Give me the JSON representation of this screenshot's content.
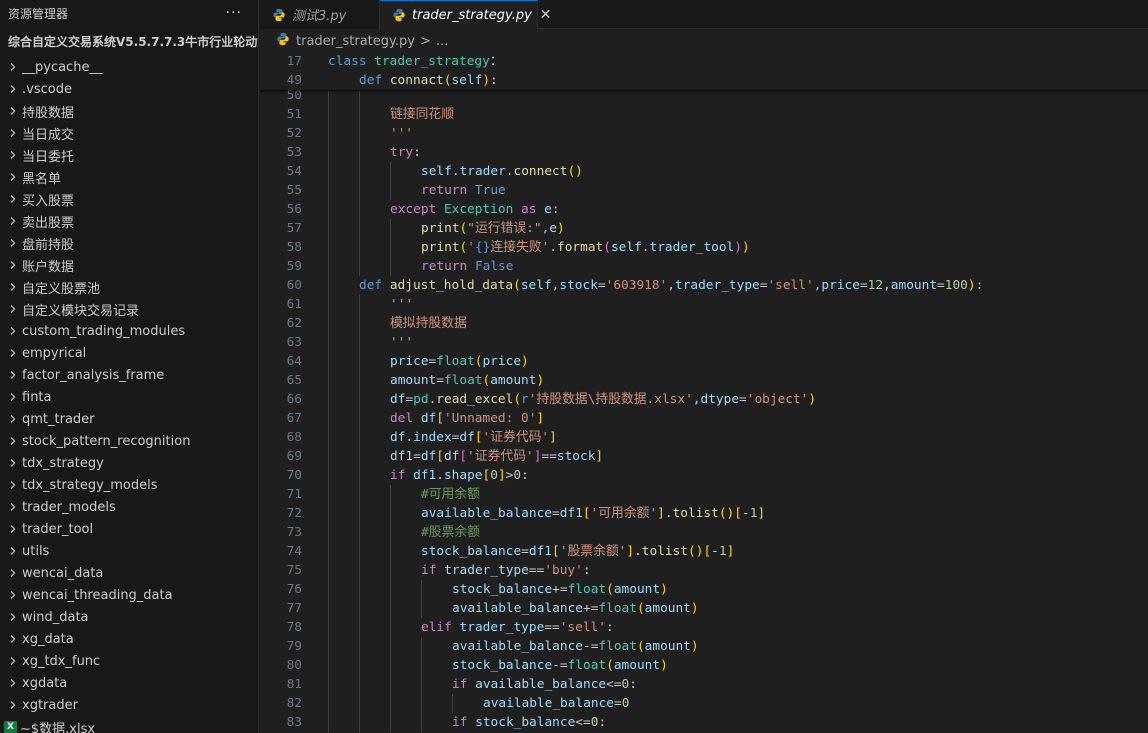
{
  "sidebar": {
    "title": "资源管理器",
    "more": "···",
    "root": "综合自定义交易系统V5.5.7.7.3牛市行业轮动策略",
    "items": [
      "__pycache__",
      ".vscode",
      "持股数据",
      "当日成交",
      "当日委托",
      "黑名单",
      "买入股票",
      "卖出股票",
      "盘前持股",
      "账户数据",
      "自定义股票池",
      "自定义模块交易记录",
      "custom_trading_modules",
      "empyrical",
      "factor_analysis_frame",
      "finta",
      "qmt_trader",
      "stock_pattern_recognition",
      "tdx_strategy",
      "tdx_strategy_models",
      "trader_models",
      "trader_tool",
      "utils",
      "wencai_data",
      "wencai_threading_data",
      "wind_data",
      "xg_data",
      "xg_tdx_func",
      "xgdata",
      "xgtrader"
    ],
    "file": "~$数据.xlsx",
    "file_icon_text": "X"
  },
  "tabs": [
    {
      "label": "测试3.py",
      "active": false
    },
    {
      "label": "trader_strategy.py",
      "active": true,
      "close": "✕"
    }
  ],
  "breadcrumb": {
    "file": "trader_strategy.py",
    "sep": ">",
    "more": "..."
  },
  "editor": {
    "sticky": [
      {
        "ln": "17",
        "indent": 0,
        "code": [
          [
            "k",
            "class"
          ],
          [
            "t",
            " trader_strategy"
          ],
          [
            "",
            "："
          ]
        ]
      },
      {
        "ln": "49",
        "indent": 1,
        "code": [
          [
            "k",
            "def"
          ],
          [
            "f",
            " connact"
          ],
          [
            "p",
            "("
          ],
          [
            "v",
            "self"
          ],
          [
            "p",
            ")"
          ],
          [
            "",
            ":"
          ]
        ]
      }
    ],
    "lines": [
      {
        "ln": "50",
        "indent": 2,
        "code": []
      },
      {
        "ln": "51",
        "indent": 2,
        "code": [
          [
            "s",
            "链接同花顺"
          ]
        ]
      },
      {
        "ln": "52",
        "indent": 2,
        "code": [
          [
            "s",
            "'''"
          ]
        ]
      },
      {
        "ln": "53",
        "indent": 2,
        "code": [
          [
            "kc",
            "try"
          ],
          [
            "",
            ":"
          ]
        ]
      },
      {
        "ln": "54",
        "indent": 3,
        "code": [
          [
            "v",
            "self"
          ],
          [
            "",
            "."
          ],
          [
            "v",
            "trader"
          ],
          [
            "",
            "."
          ],
          [
            "f",
            "connect"
          ],
          [
            "p",
            "()"
          ]
        ]
      },
      {
        "ln": "55",
        "indent": 3,
        "code": [
          [
            "kc",
            "return"
          ],
          [
            "k",
            " True"
          ]
        ]
      },
      {
        "ln": "56",
        "indent": 2,
        "code": [
          [
            "kc",
            "except"
          ],
          [
            "t",
            " Exception"
          ],
          [
            "kc",
            " as"
          ],
          [
            "v",
            " e"
          ],
          [
            "",
            ":"
          ]
        ]
      },
      {
        "ln": "57",
        "indent": 3,
        "code": [
          [
            "f",
            "print"
          ],
          [
            "p",
            "("
          ],
          [
            "s",
            "\"运行错误:\""
          ],
          [
            "",
            ","
          ],
          [
            "v",
            "e"
          ],
          [
            "p",
            ")"
          ]
        ]
      },
      {
        "ln": "58",
        "indent": 3,
        "code": [
          [
            "f",
            "print"
          ],
          [
            "p",
            "("
          ],
          [
            "s",
            "'"
          ],
          [
            "k",
            "{}"
          ],
          [
            "s",
            "连接失败'"
          ],
          [
            "",
            "."
          ],
          [
            "f",
            "format"
          ],
          [
            "p2",
            "("
          ],
          [
            "v",
            "self"
          ],
          [
            "",
            "."
          ],
          [
            "v",
            "trader_tool"
          ],
          [
            "p2",
            ")"
          ],
          [
            "p",
            ")"
          ]
        ]
      },
      {
        "ln": "59",
        "indent": 3,
        "code": [
          [
            "kc",
            "return"
          ],
          [
            "k",
            " False"
          ]
        ]
      },
      {
        "ln": "60",
        "indent": 1,
        "code": [
          [
            "k",
            "def"
          ],
          [
            "f",
            " adjust_hold_data"
          ],
          [
            "p",
            "("
          ],
          [
            "v",
            "self"
          ],
          [
            "",
            ","
          ],
          [
            "v",
            "stock"
          ],
          [
            "",
            "="
          ],
          [
            "s",
            "'603918'"
          ],
          [
            "",
            ","
          ],
          [
            "v",
            "trader_type"
          ],
          [
            "",
            "="
          ],
          [
            "s",
            "'sell'"
          ],
          [
            "",
            ","
          ],
          [
            "v",
            "price"
          ],
          [
            "",
            "="
          ],
          [
            "n",
            "12"
          ],
          [
            "",
            ","
          ],
          [
            "v",
            "amount"
          ],
          [
            "",
            "="
          ],
          [
            "n",
            "100"
          ],
          [
            "p",
            ")"
          ],
          [
            "",
            ":"
          ]
        ]
      },
      {
        "ln": "61",
        "indent": 2,
        "code": [
          [
            "s",
            "'''"
          ]
        ]
      },
      {
        "ln": "62",
        "indent": 2,
        "code": [
          [
            "s",
            "模拟持股数据"
          ]
        ]
      },
      {
        "ln": "63",
        "indent": 2,
        "code": [
          [
            "s",
            "'''"
          ]
        ]
      },
      {
        "ln": "64",
        "indent": 2,
        "code": [
          [
            "v",
            "price"
          ],
          [
            "",
            "="
          ],
          [
            "t",
            "float"
          ],
          [
            "p",
            "("
          ],
          [
            "v",
            "price"
          ],
          [
            "p",
            ")"
          ]
        ]
      },
      {
        "ln": "65",
        "indent": 2,
        "code": [
          [
            "v",
            "amount"
          ],
          [
            "",
            "="
          ],
          [
            "t",
            "float"
          ],
          [
            "p",
            "("
          ],
          [
            "v",
            "amount"
          ],
          [
            "p",
            ")"
          ]
        ]
      },
      {
        "ln": "66",
        "indent": 2,
        "code": [
          [
            "v",
            "df"
          ],
          [
            "",
            "="
          ],
          [
            "t",
            "pd"
          ],
          [
            "",
            "."
          ],
          [
            "f",
            "read_excel"
          ],
          [
            "p",
            "("
          ],
          [
            "k",
            "r"
          ],
          [
            "s",
            "'持股数据\\持股数据.xlsx'"
          ],
          [
            "",
            ","
          ],
          [
            "v",
            "dtype"
          ],
          [
            "",
            "="
          ],
          [
            "s",
            "'object'"
          ],
          [
            "p",
            ")"
          ]
        ]
      },
      {
        "ln": "67",
        "indent": 2,
        "code": [
          [
            "kc",
            "del"
          ],
          [
            "v",
            " df"
          ],
          [
            "p",
            "["
          ],
          [
            "s",
            "'Unnamed: 0'"
          ],
          [
            "p",
            "]"
          ]
        ]
      },
      {
        "ln": "68",
        "indent": 2,
        "code": [
          [
            "v",
            "df"
          ],
          [
            "",
            "."
          ],
          [
            "v",
            "index"
          ],
          [
            "",
            "="
          ],
          [
            "v",
            "df"
          ],
          [
            "p",
            "["
          ],
          [
            "s",
            "'证券代码'"
          ],
          [
            "p",
            "]"
          ]
        ]
      },
      {
        "ln": "69",
        "indent": 2,
        "code": [
          [
            "v",
            "df1"
          ],
          [
            "",
            "="
          ],
          [
            "v",
            "df"
          ],
          [
            "p",
            "["
          ],
          [
            "v",
            "df"
          ],
          [
            "p2",
            "["
          ],
          [
            "s",
            "'证券代码'"
          ],
          [
            "p2",
            "]"
          ],
          [
            "",
            "=="
          ],
          [
            "v",
            "stock"
          ],
          [
            "p",
            "]"
          ]
        ]
      },
      {
        "ln": "70",
        "indent": 2,
        "code": [
          [
            "kc",
            "if"
          ],
          [
            "v",
            " df1"
          ],
          [
            "",
            "."
          ],
          [
            "v",
            "shape"
          ],
          [
            "p",
            "["
          ],
          [
            "n",
            "0"
          ],
          [
            "p",
            "]"
          ],
          [
            "",
            ">"
          ],
          [
            "n",
            "0"
          ],
          [
            "",
            ":"
          ]
        ]
      },
      {
        "ln": "71",
        "indent": 3,
        "code": [
          [
            "c",
            "#可用余额"
          ]
        ]
      },
      {
        "ln": "72",
        "indent": 3,
        "code": [
          [
            "v",
            "available_balance"
          ],
          [
            "",
            "="
          ],
          [
            "v",
            "df1"
          ],
          [
            "p",
            "["
          ],
          [
            "s",
            "'可用余额'"
          ],
          [
            "p",
            "]"
          ],
          [
            "",
            "."
          ],
          [
            "f",
            "tolist"
          ],
          [
            "p",
            "()"
          ],
          [
            "p",
            "["
          ],
          [
            "",
            "-"
          ],
          [
            "n",
            "1"
          ],
          [
            "p",
            "]"
          ]
        ]
      },
      {
        "ln": "73",
        "indent": 3,
        "code": [
          [
            "c",
            "#股票余额"
          ]
        ]
      },
      {
        "ln": "74",
        "indent": 3,
        "code": [
          [
            "v",
            "stock_balance"
          ],
          [
            "",
            "="
          ],
          [
            "v",
            "df1"
          ],
          [
            "p",
            "["
          ],
          [
            "s",
            "'股票余额'"
          ],
          [
            "p",
            "]"
          ],
          [
            "",
            "."
          ],
          [
            "f",
            "tolist"
          ],
          [
            "p",
            "()"
          ],
          [
            "p",
            "["
          ],
          [
            "",
            "-"
          ],
          [
            "n",
            "1"
          ],
          [
            "p",
            "]"
          ]
        ]
      },
      {
        "ln": "75",
        "indent": 3,
        "code": [
          [
            "kc",
            "if"
          ],
          [
            "v",
            " trader_type"
          ],
          [
            "",
            "=="
          ],
          [
            "s",
            "'buy'"
          ],
          [
            "",
            ":"
          ]
        ]
      },
      {
        "ln": "76",
        "indent": 4,
        "code": [
          [
            "v",
            "stock_balance"
          ],
          [
            "",
            "+="
          ],
          [
            "t",
            "float"
          ],
          [
            "p",
            "("
          ],
          [
            "v",
            "amount"
          ],
          [
            "p",
            ")"
          ]
        ]
      },
      {
        "ln": "77",
        "indent": 4,
        "code": [
          [
            "v",
            "available_balance"
          ],
          [
            "",
            "+="
          ],
          [
            "t",
            "float"
          ],
          [
            "p",
            "("
          ],
          [
            "v",
            "amount"
          ],
          [
            "p",
            ")"
          ]
        ]
      },
      {
        "ln": "78",
        "indent": 3,
        "code": [
          [
            "kc",
            "elif"
          ],
          [
            "v",
            " trader_type"
          ],
          [
            "",
            "=="
          ],
          [
            "s",
            "'sell'"
          ],
          [
            "",
            ":"
          ]
        ]
      },
      {
        "ln": "79",
        "indent": 4,
        "code": [
          [
            "v",
            "available_balance"
          ],
          [
            "",
            "-="
          ],
          [
            "t",
            "float"
          ],
          [
            "p",
            "("
          ],
          [
            "v",
            "amount"
          ],
          [
            "p",
            ")"
          ]
        ]
      },
      {
        "ln": "80",
        "indent": 4,
        "code": [
          [
            "v",
            "stock_balance"
          ],
          [
            "",
            "-="
          ],
          [
            "t",
            "float"
          ],
          [
            "p",
            "("
          ],
          [
            "v",
            "amount"
          ],
          [
            "p",
            ")"
          ]
        ]
      },
      {
        "ln": "81",
        "indent": 4,
        "code": [
          [
            "kc",
            "if"
          ],
          [
            "v",
            " available_balance"
          ],
          [
            "",
            "<="
          ],
          [
            "n",
            "0"
          ],
          [
            "",
            ":"
          ]
        ]
      },
      {
        "ln": "82",
        "indent": 5,
        "code": [
          [
            "v",
            "available_balance"
          ],
          [
            "",
            "="
          ],
          [
            "n",
            "0"
          ]
        ]
      },
      {
        "ln": "83",
        "indent": 4,
        "code": [
          [
            "kc",
            "if"
          ],
          [
            "v",
            " stock_balance"
          ],
          [
            "",
            "<="
          ],
          [
            "n",
            "0"
          ],
          [
            "",
            ":"
          ]
        ]
      }
    ]
  },
  "colors": {
    "background": "#1f1f1f",
    "sidebar": "#181818",
    "accent": "#0078d4",
    "keyword": "#569cd6",
    "control": "#c586c0",
    "function": "#dcdcaa",
    "variable": "#9cdcfe",
    "string": "#ce9178",
    "number": "#b5cea8",
    "comment": "#6a9955",
    "type": "#4ec9b0"
  }
}
